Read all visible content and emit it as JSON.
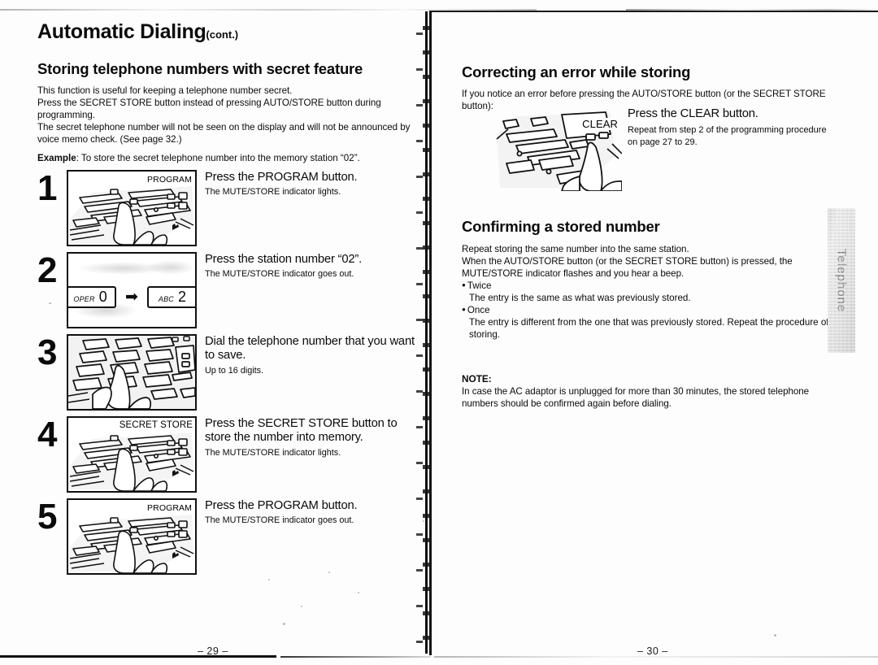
{
  "document": {
    "title": "Automatic Dialing",
    "title_suffix": "(cont.)"
  },
  "left_page": {
    "page_number": "– 29 –",
    "section_title": "Storing telephone numbers with secret feature",
    "intro_paragraphs": [
      "This function is useful for keeping a telephone number secret.",
      "Press the SECRET STORE button instead of pressing AUTO/STORE button during programming.",
      "The secret telephone number will not be seen on the display and will not be announced by voice memo check. (See page 32.)"
    ],
    "example_label": "Example",
    "example_text": ":  To store the secret telephone number into the memory station “02”.",
    "steps": [
      {
        "number": "1",
        "figure_label": "PROGRAM",
        "figure_type": "phone-console",
        "heading": "Press the PROGRAM button.",
        "subtext": "The MUTE/STORE indicator lights."
      },
      {
        "number": "2",
        "figure_type": "keycaps",
        "keycap_from_small": "OPER",
        "keycap_from_big": "0",
        "keycap_arrow": "➡",
        "keycap_to_small": "ABC",
        "keycap_to_big": "2",
        "heading": "Press the station number “02”.",
        "subtext": "The MUTE/STORE indicator goes out."
      },
      {
        "number": "3",
        "figure_type": "dial-keypad",
        "figure_label": "",
        "heading": "Dial the telephone number that you want to save.",
        "subtext": "Up to 16 digits."
      },
      {
        "number": "4",
        "figure_label": "SECRET STORE",
        "figure_type": "phone-console",
        "heading": "Press the SECRET STORE button to store the number into memory.",
        "subtext": "The MUTE/STORE indicator lights."
      },
      {
        "number": "5",
        "figure_label": "PROGRAM",
        "figure_type": "phone-console",
        "heading": "Press the PROGRAM button.",
        "subtext": "The MUTE/STORE indicator goes out."
      }
    ]
  },
  "right_page": {
    "page_number": "– 30 –",
    "correcting": {
      "section_title": "Correcting an error while storing",
      "intro": "If you notice an error before pressing the AUTO/STORE button (or the SECRET STORE button):",
      "figure_label": "CLEAR",
      "heading": "Press the CLEAR button.",
      "subtext": "Repeat from step 2 of the programming procedure on page 27 to 29."
    },
    "confirming": {
      "section_title": "Confirming a stored number",
      "paragraphs": [
        "Repeat storing the same number into the same station.",
        "When the AUTO/STORE button (or the SECRET STORE button) is pressed, the MUTE/STORE indicator flashes and you hear a beep."
      ],
      "bullets": [
        {
          "head": "Twice",
          "body": "The entry is the same as what was previously stored."
        },
        {
          "head": "Once",
          "body": "The entry is different from the one that was previously stored. Repeat the procedure of storing."
        }
      ]
    },
    "note": {
      "title": "NOTE:",
      "text": "In case the AC adaptor is unplugged for more than 30 minutes, the stored telephone numbers should be confirmed again before dialing."
    }
  },
  "thumb_tab": {
    "label": "Telephone"
  },
  "colors": {
    "ink": "#0a0a0a",
    "page_background": "#fdfdfd",
    "tab_gray": "#dcdcdc"
  }
}
